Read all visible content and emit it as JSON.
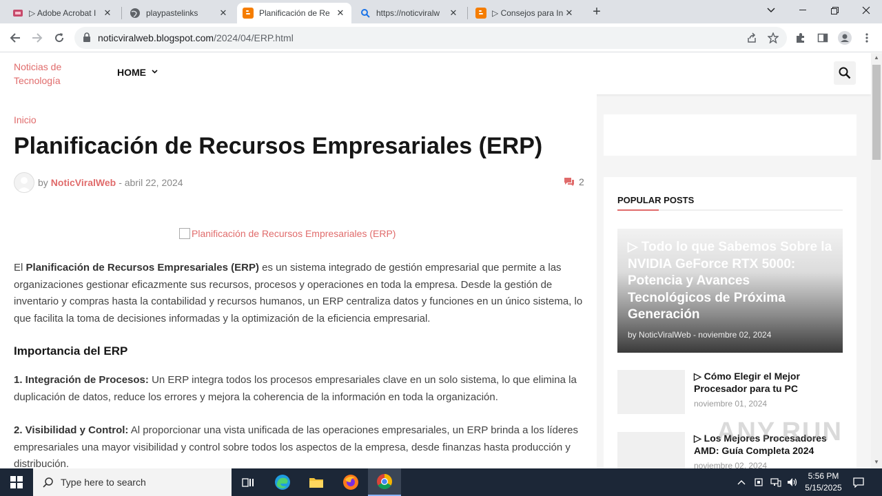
{
  "browser": {
    "tabs": [
      {
        "title": "▷ Adobe Acrobat I",
        "favicon": "acrobat-icon"
      },
      {
        "title": "playpastelinks",
        "favicon": "globe-icon"
      },
      {
        "title": "Planificación de Re",
        "favicon": "blogger-icon",
        "active": true
      },
      {
        "title": "https://noticviralw",
        "favicon": "search-icon"
      },
      {
        "title": "▷ Consejos para In",
        "favicon": "blogger-icon"
      }
    ],
    "url_domain": "noticviralweb.blogspot.com",
    "url_path": "/2024/04/ERP.html"
  },
  "site": {
    "logo_alt": "Noticias de Tecnología",
    "nav_home": "HOME"
  },
  "article": {
    "breadcrumb": "Inicio",
    "title": "Planificación de Recursos Empresariales (ERP)",
    "by": "by",
    "author": "NoticViralWeb",
    "date": "- abril 22, 2024",
    "comment_count": "2",
    "hero_alt": "Planificación de Recursos Empresariales (ERP)",
    "intro_pre": " El ",
    "intro_bold": "Planificación de Recursos Empresariales (ERP)",
    "intro_rest": " es un sistema integrado de gestión empresarial que permite a las organizaciones gestionar eficazmente sus recursos, procesos y operaciones en toda la empresa. Desde la gestión de inventario y compras hasta la contabilidad y recursos humanos, un ERP centraliza datos y funciones en un único sistema, lo que facilita la toma de decisiones informadas y la optimización de la eficiencia empresarial.",
    "section_heading": "Importancia del ERP",
    "points": [
      {
        "label": "1. Integración de Procesos:",
        "text": " Un ERP integra todos los procesos empresariales clave en un solo sistema, lo que elimina la duplicación de datos, reduce los errores y mejora la coherencia de la información en toda la organización."
      },
      {
        "label": "2. Visibilidad y Control:",
        "text": " Al proporcionar una vista unificada de las operaciones empresariales, un ERP brinda a los líderes empresariales una mayor visibilidad y control sobre todos los aspectos de la empresa, desde finanzas hasta producción y distribución."
      }
    ]
  },
  "sidebar": {
    "popular_title": "POPULAR POSTS",
    "featured": {
      "title": "▷ Todo lo que Sabemos Sobre la NVIDIA GeForce RTX 5000: Potencia y Avances Tecnológicos de Próxima Generación",
      "by": "by",
      "author": "NoticViralWeb",
      "date": "- noviembre 02, 2024"
    },
    "items": [
      {
        "title": "▷ Cómo Elegir el Mejor Procesador para tu PC",
        "date": "noviembre 01, 2024"
      },
      {
        "title": "▷ Los Mejores Procesadores AMD: Guía Completa 2024",
        "date": "noviembre 02, 2024"
      }
    ]
  },
  "watermark": "ANY.RUN",
  "taskbar": {
    "search_placeholder": "Type here to search",
    "time": "5:56 PM",
    "date": "5/15/2025"
  }
}
